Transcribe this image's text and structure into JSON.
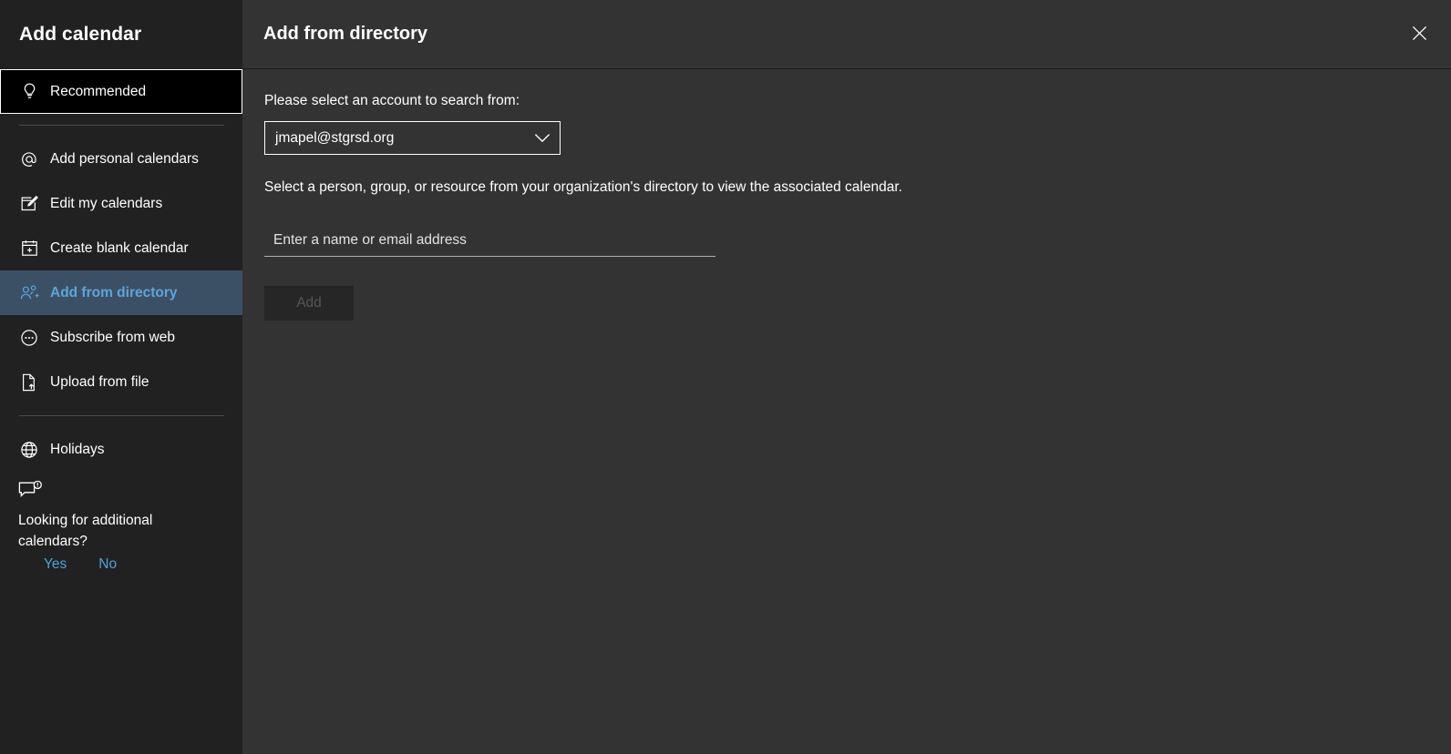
{
  "sidebar": {
    "title": "Add calendar",
    "items": [
      {
        "label": "Recommended",
        "icon": "lightbulb-icon",
        "state": "focused"
      },
      {
        "label": "Add personal calendars",
        "icon": "at-sign-icon",
        "state": "normal"
      },
      {
        "label": "Edit my calendars",
        "icon": "edit-note-icon",
        "state": "normal"
      },
      {
        "label": "Create blank calendar",
        "icon": "calendar-plus-icon",
        "state": "normal"
      },
      {
        "label": "Add from directory",
        "icon": "person-add-icon",
        "state": "selected"
      },
      {
        "label": "Subscribe from web",
        "icon": "subscribe-circle-icon",
        "state": "normal"
      },
      {
        "label": "Upload from file",
        "icon": "file-upload-icon",
        "state": "normal"
      },
      {
        "label": "Holidays",
        "icon": "globe-icon",
        "state": "normal"
      }
    ],
    "feedback": {
      "icon": "feedback-bubble-icon",
      "question": "Looking for additional calendars?",
      "yes_label": "Yes",
      "no_label": "No"
    }
  },
  "main": {
    "title": "Add from directory",
    "close_icon": "close-icon",
    "account_label": "Please select an account to search from:",
    "account_value": "jmapel@stgrsd.org",
    "account_chevron_icon": "chevron-down-icon",
    "helper_text": "Select a person, group, or resource from your organization's directory to view the associated calendar.",
    "search_placeholder": "Enter a name or email address",
    "search_value": "",
    "add_button_label": "Add",
    "add_button_enabled": false
  },
  "colors": {
    "sidebar_bg": "#212121",
    "main_bg": "#333333",
    "selected_bg": "#3c5065",
    "accent_blue": "#5ba5dc",
    "link_blue": "#4fa3db",
    "text": "#ffffff",
    "disabled_text": "#555555"
  }
}
